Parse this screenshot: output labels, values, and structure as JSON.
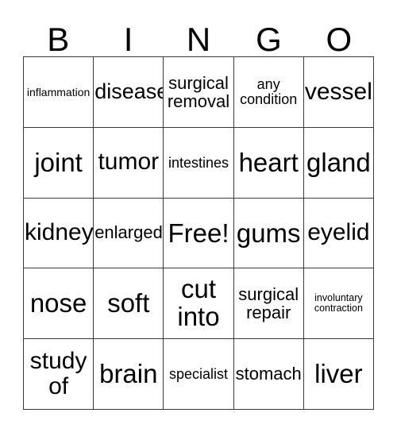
{
  "header": {
    "letters": [
      "B",
      "I",
      "N",
      "G",
      "O"
    ]
  },
  "grid": {
    "columns": 5,
    "rows": 5,
    "line_color": "#3a3a3a",
    "background": "#ffffff",
    "text_color": "#000000",
    "cells": [
      {
        "text": "inflammation",
        "size": "xs",
        "lines": 1
      },
      {
        "text": "disease",
        "size": "lg",
        "lines": 1
      },
      {
        "text": "surgical\nremoval",
        "size": "md",
        "lines": 2
      },
      {
        "text": "any\ncondition",
        "size": "sm",
        "lines": 2
      },
      {
        "text": "vessel",
        "size": "xl",
        "lines": 1
      },
      {
        "text": "joint",
        "size": "xxl",
        "lines": 1
      },
      {
        "text": "tumor",
        "size": "xl",
        "lines": 1
      },
      {
        "text": "intestines",
        "size": "sm",
        "lines": 1
      },
      {
        "text": "heart",
        "size": "xxl",
        "lines": 1
      },
      {
        "text": "gland",
        "size": "xxl",
        "lines": 1
      },
      {
        "text": "kidney",
        "size": "xl",
        "lines": 1
      },
      {
        "text": "enlarged",
        "size": "md",
        "lines": 1
      },
      {
        "text": "Free!",
        "size": "xxl",
        "lines": 1
      },
      {
        "text": "gums",
        "size": "xxl",
        "lines": 1
      },
      {
        "text": "eyelid",
        "size": "xl",
        "lines": 1
      },
      {
        "text": "nose",
        "size": "xxl",
        "lines": 1
      },
      {
        "text": "soft",
        "size": "xxl",
        "lines": 1
      },
      {
        "text": "cut\ninto",
        "size": "xxl",
        "lines": 2
      },
      {
        "text": "surgical\nrepair",
        "size": "md",
        "lines": 2
      },
      {
        "text": "involuntary\ncontraction",
        "size": "xxs",
        "lines": 2
      },
      {
        "text": "study\nof",
        "size": "xl",
        "lines": 2
      },
      {
        "text": "brain",
        "size": "xxl",
        "lines": 1
      },
      {
        "text": "specialist",
        "size": "sm",
        "lines": 1
      },
      {
        "text": "stomach",
        "size": "md",
        "lines": 1
      },
      {
        "text": "liver",
        "size": "xxl",
        "lines": 1
      }
    ]
  }
}
